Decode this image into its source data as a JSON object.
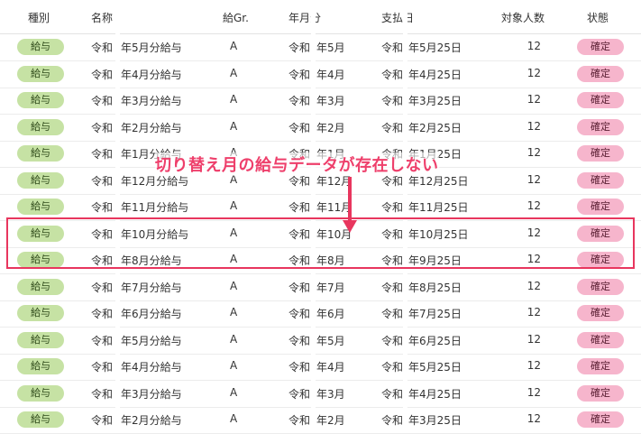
{
  "columns": {
    "type": "種別",
    "name": "名称",
    "grade": "給Gr.",
    "month": "年月分",
    "payday": "支払日",
    "count": "対象人数",
    "status": "状態"
  },
  "rows": [
    {
      "type": "給与",
      "name_prefix": "令和",
      "name": "年5月分給与",
      "grade": "A",
      "month_prefix": "令和",
      "month": "年5月",
      "pay_prefix": "令和",
      "pay": "年5月25日",
      "count": "12",
      "status": "確定"
    },
    {
      "type": "給与",
      "name_prefix": "令和",
      "name": "年4月分給与",
      "grade": "A",
      "month_prefix": "令和",
      "month": "年4月",
      "pay_prefix": "令和",
      "pay": "年4月25日",
      "count": "12",
      "status": "確定"
    },
    {
      "type": "給与",
      "name_prefix": "令和",
      "name": "年3月分給与",
      "grade": "A",
      "month_prefix": "令和",
      "month": "年3月",
      "pay_prefix": "令和",
      "pay": "年3月25日",
      "count": "12",
      "status": "確定"
    },
    {
      "type": "給与",
      "name_prefix": "令和",
      "name": "年2月分給与",
      "grade": "A",
      "month_prefix": "令和",
      "month": "年2月",
      "pay_prefix": "令和",
      "pay": "年2月25日",
      "count": "12",
      "status": "確定"
    },
    {
      "type": "給与",
      "name_prefix": "令和",
      "name": "年1月分給与",
      "grade": "A",
      "month_prefix": "令和",
      "month": "年1月",
      "pay_prefix": "令和",
      "pay": "年1月25日",
      "count": "12",
      "status": "確定"
    },
    {
      "type": "給与",
      "name_prefix": "令和",
      "name": "年12月分給与",
      "grade": "A",
      "month_prefix": "令和",
      "month": "年12月",
      "pay_prefix": "令和",
      "pay": "年12月25日",
      "count": "12",
      "status": "確定"
    },
    {
      "type": "給与",
      "name_prefix": "令和",
      "name": "年11月分給与",
      "grade": "A",
      "month_prefix": "令和",
      "month": "年11月",
      "pay_prefix": "令和",
      "pay": "年11月25日",
      "count": "12",
      "status": "確定"
    },
    {
      "type": "給与",
      "name_prefix": "令和",
      "name": "年10月分給与",
      "grade": "A",
      "month_prefix": "令和",
      "month": "年10月",
      "pay_prefix": "令和",
      "pay": "年10月25日",
      "count": "12",
      "status": "確定"
    },
    {
      "type": "給与",
      "name_prefix": "令和",
      "name": "年8月分給与",
      "grade": "A",
      "month_prefix": "令和",
      "month": "年8月",
      "pay_prefix": "令和",
      "pay": "年9月25日",
      "count": "12",
      "status": "確定"
    },
    {
      "type": "給与",
      "name_prefix": "令和",
      "name": "年7月分給与",
      "grade": "A",
      "month_prefix": "令和",
      "month": "年7月",
      "pay_prefix": "令和",
      "pay": "年8月25日",
      "count": "12",
      "status": "確定"
    },
    {
      "type": "給与",
      "name_prefix": "令和",
      "name": "年6月分給与",
      "grade": "A",
      "month_prefix": "令和",
      "month": "年6月",
      "pay_prefix": "令和",
      "pay": "年7月25日",
      "count": "12",
      "status": "確定"
    },
    {
      "type": "給与",
      "name_prefix": "令和",
      "name": "年5月分給与",
      "grade": "A",
      "month_prefix": "令和",
      "month": "年5月",
      "pay_prefix": "令和",
      "pay": "年6月25日",
      "count": "12",
      "status": "確定"
    },
    {
      "type": "給与",
      "name_prefix": "令和",
      "name": "年4月分給与",
      "grade": "A",
      "month_prefix": "令和",
      "month": "年4月",
      "pay_prefix": "令和",
      "pay": "年5月25日",
      "count": "12",
      "status": "確定"
    },
    {
      "type": "給与",
      "name_prefix": "令和",
      "name": "年3月分給与",
      "grade": "A",
      "month_prefix": "令和",
      "month": "年3月",
      "pay_prefix": "令和",
      "pay": "年4月25日",
      "count": "12",
      "status": "確定"
    },
    {
      "type": "給与",
      "name_prefix": "令和",
      "name": "年2月分給与",
      "grade": "A",
      "month_prefix": "令和",
      "month": "年2月",
      "pay_prefix": "令和",
      "pay": "年3月25日",
      "count": "12",
      "status": "確定"
    }
  ],
  "annotation": {
    "callout": "切り替え月の給与データが存在しない"
  },
  "colors": {
    "type_badge": "#c6e2a4",
    "status_badge": "#f6b5cc",
    "annotation": "#e8365e"
  }
}
